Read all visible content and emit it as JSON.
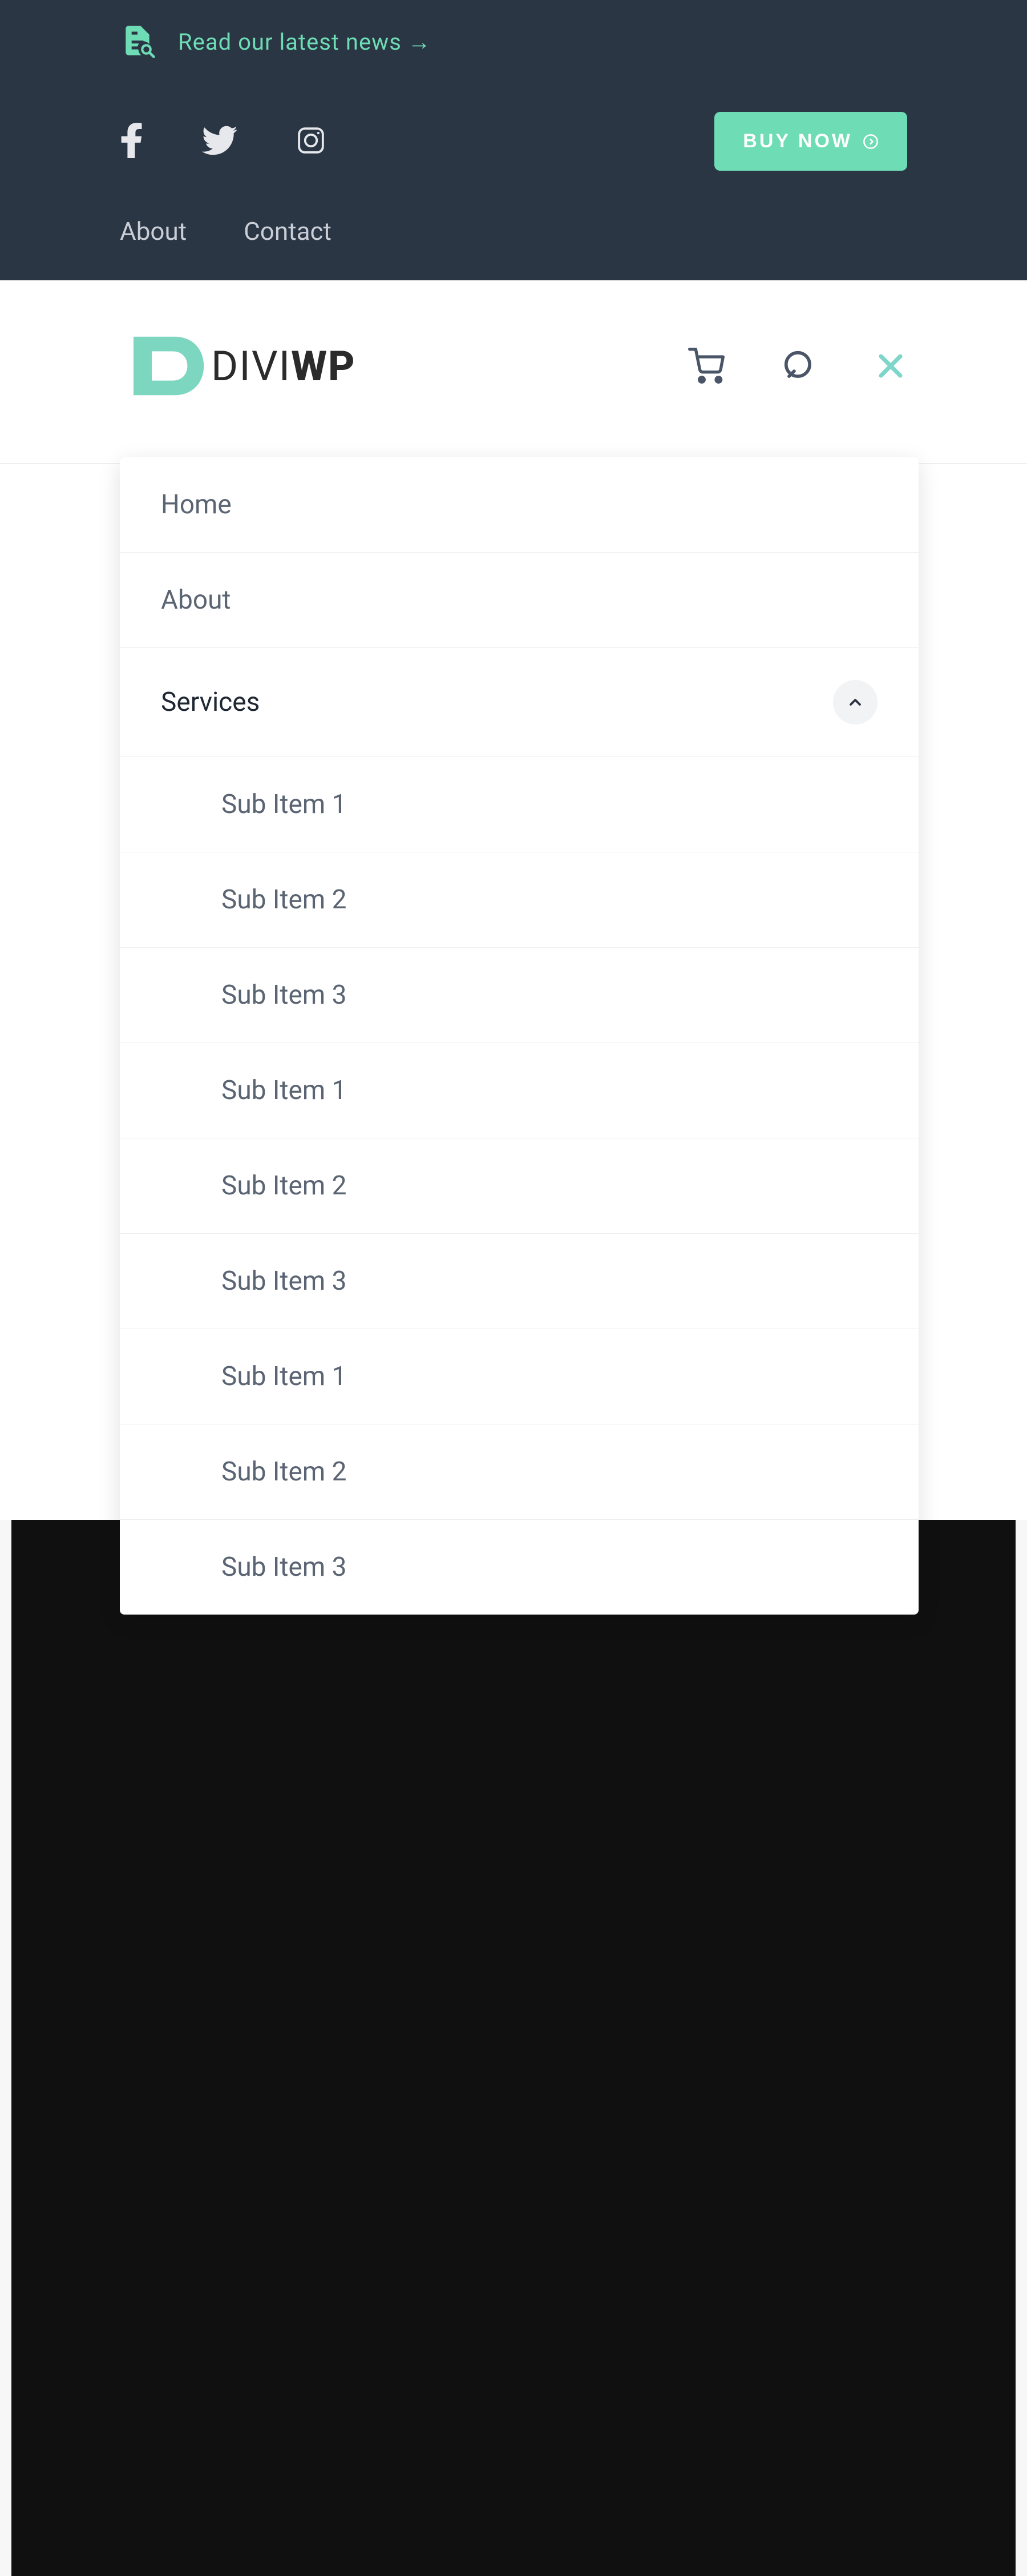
{
  "topbar": {
    "news_link": "Read our latest news →",
    "buy_button": "BUY NOW",
    "links": [
      "About",
      "Contact"
    ]
  },
  "logo": {
    "part1": "DIVI",
    "part2": "WP"
  },
  "menu": {
    "items": [
      {
        "label": "Home",
        "active": false,
        "expanded": false
      },
      {
        "label": "About",
        "active": false,
        "expanded": false
      },
      {
        "label": "Services",
        "active": true,
        "expanded": true
      }
    ],
    "sub_items": [
      "Sub Item 1",
      "Sub Item 2",
      "Sub Item 3",
      "Sub Item 1",
      "Sub Item 2",
      "Sub Item 3",
      "Sub Item 1",
      "Sub Item 2",
      "Sub Item 3"
    ]
  }
}
